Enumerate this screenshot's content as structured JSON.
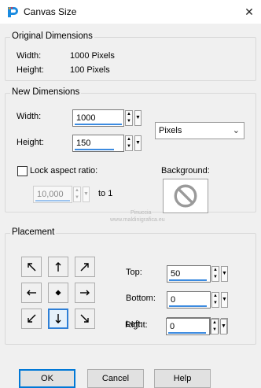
{
  "window": {
    "title": "Canvas Size"
  },
  "original": {
    "title": "Original Dimensions",
    "width_label": "Width:",
    "width_value": "1000 Pixels",
    "height_label": "Height:",
    "height_value": "100 Pixels"
  },
  "new_dims": {
    "title": "New Dimensions",
    "width_label": "Width:",
    "width_value": "1000",
    "height_label": "Height:",
    "height_value": "150",
    "units": "Pixels",
    "lock_label": "Lock aspect ratio:",
    "lock_checked": false,
    "ratio_value": "10,000",
    "ratio_suffix": "to 1",
    "background_label": "Background:"
  },
  "placement": {
    "title": "Placement",
    "top_label": "Top:",
    "top_value": "50",
    "bottom_label": "Bottom:",
    "bottom_value": "0",
    "left_label": "Left:",
    "left_value": "0",
    "right_label": "Right:",
    "right_value": "0",
    "selected_anchor": "bottom-center"
  },
  "watermark": {
    "line1": "Pinuccia",
    "line2": "www.maldinigrafica.eu"
  },
  "buttons": {
    "ok": "OK",
    "cancel": "Cancel",
    "help": "Help"
  }
}
